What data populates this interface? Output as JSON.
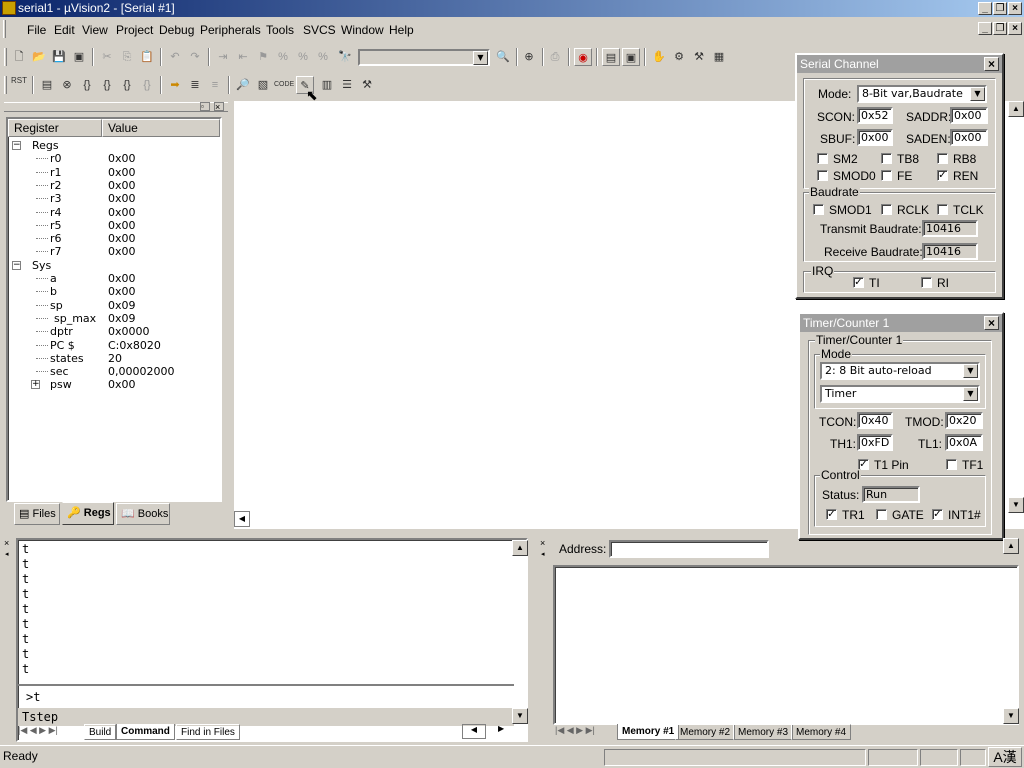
{
  "window": {
    "title": "serial1  - µVision2 - [Serial #1]"
  },
  "menu": [
    "File",
    "Edit",
    "View",
    "Project",
    "Debug",
    "Peripherals",
    "Tools",
    "SVCS",
    "Window",
    "Help"
  ],
  "registers": {
    "headers": [
      "Register",
      "Value"
    ],
    "groups": [
      {
        "name": "Regs",
        "rows": [
          [
            "r0",
            "0x00"
          ],
          [
            "r1",
            "0x00"
          ],
          [
            "r2",
            "0x00"
          ],
          [
            "r3",
            "0x00"
          ],
          [
            "r4",
            "0x00"
          ],
          [
            "r5",
            "0x00"
          ],
          [
            "r6",
            "0x00"
          ],
          [
            "r7",
            "0x00"
          ]
        ]
      },
      {
        "name": "Sys",
        "rows": [
          [
            "a",
            "0x00"
          ],
          [
            "b",
            "0x00"
          ],
          [
            "sp",
            "0x09"
          ],
          [
            "sp_max",
            "0x09"
          ],
          [
            "dptr",
            "0x0000"
          ],
          [
            "PC  $",
            "C:0x8020"
          ],
          [
            "states",
            "20"
          ],
          [
            "sec",
            "0,00002000"
          ],
          [
            "psw",
            "0x00"
          ]
        ]
      }
    ],
    "tabs": [
      "Files",
      "Regs",
      "Books"
    ]
  },
  "serial": {
    "title": "Serial Channel",
    "mode_label": "Mode:",
    "mode_value": "8-Bit var,Baudrate",
    "scon_label": "SCON:",
    "scon": "0x52",
    "saddr_label": "SADDR:",
    "saddr": "0x00",
    "sbuf_label": "SBUF:",
    "sbuf": "0x00",
    "saden_label": "SADEN:",
    "saden": "0x00",
    "flags": [
      {
        "label": "SM2",
        "checked": false
      },
      {
        "label": "TB8",
        "checked": false
      },
      {
        "label": "RB8",
        "checked": false
      },
      {
        "label": "SMOD0",
        "checked": false
      },
      {
        "label": "FE",
        "checked": false
      },
      {
        "label": "REN",
        "checked": true
      }
    ],
    "baud_group": "Baudrate",
    "baud_flags": [
      {
        "label": "SMOD1",
        "checked": false
      },
      {
        "label": "RCLK",
        "checked": false
      },
      {
        "label": "TCLK",
        "checked": false
      }
    ],
    "tx_label": "Transmit Baudrate:",
    "tx": "10416",
    "rx_label": "Receive Baudrate:",
    "rx": "10416",
    "irq_group": "IRQ",
    "irq_flags": [
      {
        "label": "TI",
        "checked": true
      },
      {
        "label": "RI",
        "checked": false
      }
    ]
  },
  "timer": {
    "title": "Timer/Counter 1",
    "group": "Timer/Counter 1",
    "mode_group": "Mode",
    "mode_value": "2: 8 Bit auto-reload",
    "type_value": "Timer",
    "tcon_label": "TCON:",
    "tcon": "0x40",
    "tmod_label": "TMOD:",
    "tmod": "0x20",
    "th1_label": "TH1:",
    "th1": "0xFD",
    "tl1_label": "TL1:",
    "tl1": "0x0A",
    "t1pin": {
      "label": "T1 Pin",
      "checked": true
    },
    "tf1": {
      "label": "TF1",
      "checked": false
    },
    "control_group": "Control",
    "status_label": "Status:",
    "status": "Run",
    "ctrl_flags": [
      {
        "label": "TR1",
        "checked": true
      },
      {
        "label": "GATE",
        "checked": false
      },
      {
        "label": "INT1#",
        "checked": true
      }
    ]
  },
  "command": {
    "output": [
      "t",
      "t",
      "t",
      "t",
      "t",
      "t",
      "t",
      "t",
      "t"
    ],
    "prompt": ">t",
    "hint": "Tstep",
    "tabs": [
      "Build",
      "Command",
      "Find in Files"
    ]
  },
  "memory": {
    "address_label": "Address:",
    "address": "",
    "tabs": [
      "Memory #1",
      "Memory #2",
      "Memory #3",
      "Memory #4"
    ]
  },
  "status": {
    "text": "Ready",
    "ime": "A漢"
  }
}
